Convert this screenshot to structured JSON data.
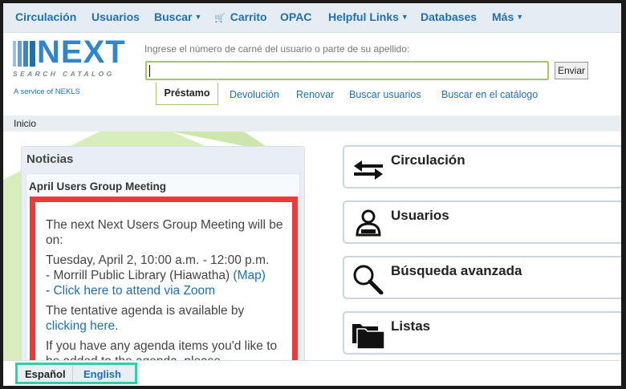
{
  "nav": {
    "items": [
      {
        "label": "Circulación",
        "dropdown": false
      },
      {
        "label": "Usuarios",
        "dropdown": false
      },
      {
        "label": "Buscar",
        "dropdown": true
      },
      {
        "label": "Carrito",
        "dropdown": false,
        "icon": "cart-icon"
      },
      {
        "label": "OPAC",
        "dropdown": false
      },
      {
        "label": "Helpful Links",
        "dropdown": true
      },
      {
        "label": "Databases",
        "dropdown": false
      },
      {
        "label": "Más",
        "dropdown": true
      }
    ]
  },
  "logo": {
    "wordmark": "NEXT",
    "tagline": "SEARCH CATALOG",
    "service": "A service of NEKLS"
  },
  "search": {
    "hint": "Ingrese el número de carné del usuario o parte de su apellido:",
    "value": "",
    "submit_label": "Enviar"
  },
  "tabs": [
    {
      "label": "Préstamo",
      "active": true
    },
    {
      "label": "Devolución",
      "active": false
    },
    {
      "label": "Renovar",
      "active": false
    },
    {
      "label": "Buscar usuarios",
      "active": false
    },
    {
      "label": "Buscar en el catálogo",
      "active": false
    }
  ],
  "breadcrumb": {
    "home": "Inicio"
  },
  "news": {
    "heading": "Noticias",
    "item_title": "April Users Group Meeting",
    "p1": "The next Next Users Group Meeting will be on:",
    "p2_line1": "Tuesday, April 2, 10:00 a.m. - 12:00 p.m.",
    "p2_line2": "- Morrill Public Library (Hiawatha) ",
    "map_link": "(Map)",
    "p2_line3_prefix": "- ",
    "zoom_link": "Click here to attend via Zoom",
    "p3_text": "The tentative agenda is available by ",
    "p3_link": "clicking here.",
    "p4": "If you have any agenda items you'd like to be added to the agenda, please"
  },
  "quick_links": [
    {
      "label": "Circulación",
      "icon": "circulation-arrows-icon"
    },
    {
      "label": "Usuarios",
      "icon": "patron-icon"
    },
    {
      "label": "Búsqueda avanzada",
      "icon": "search-icon"
    },
    {
      "label": "Listas",
      "icon": "folder-icon"
    }
  ],
  "languages": {
    "current": "Español",
    "other": "English"
  },
  "colors": {
    "link": "#1f6fb2",
    "highlight_red": "#ee3a3a",
    "highlight_teal": "#2fcfa7",
    "accent_green": "#a5c86a"
  }
}
